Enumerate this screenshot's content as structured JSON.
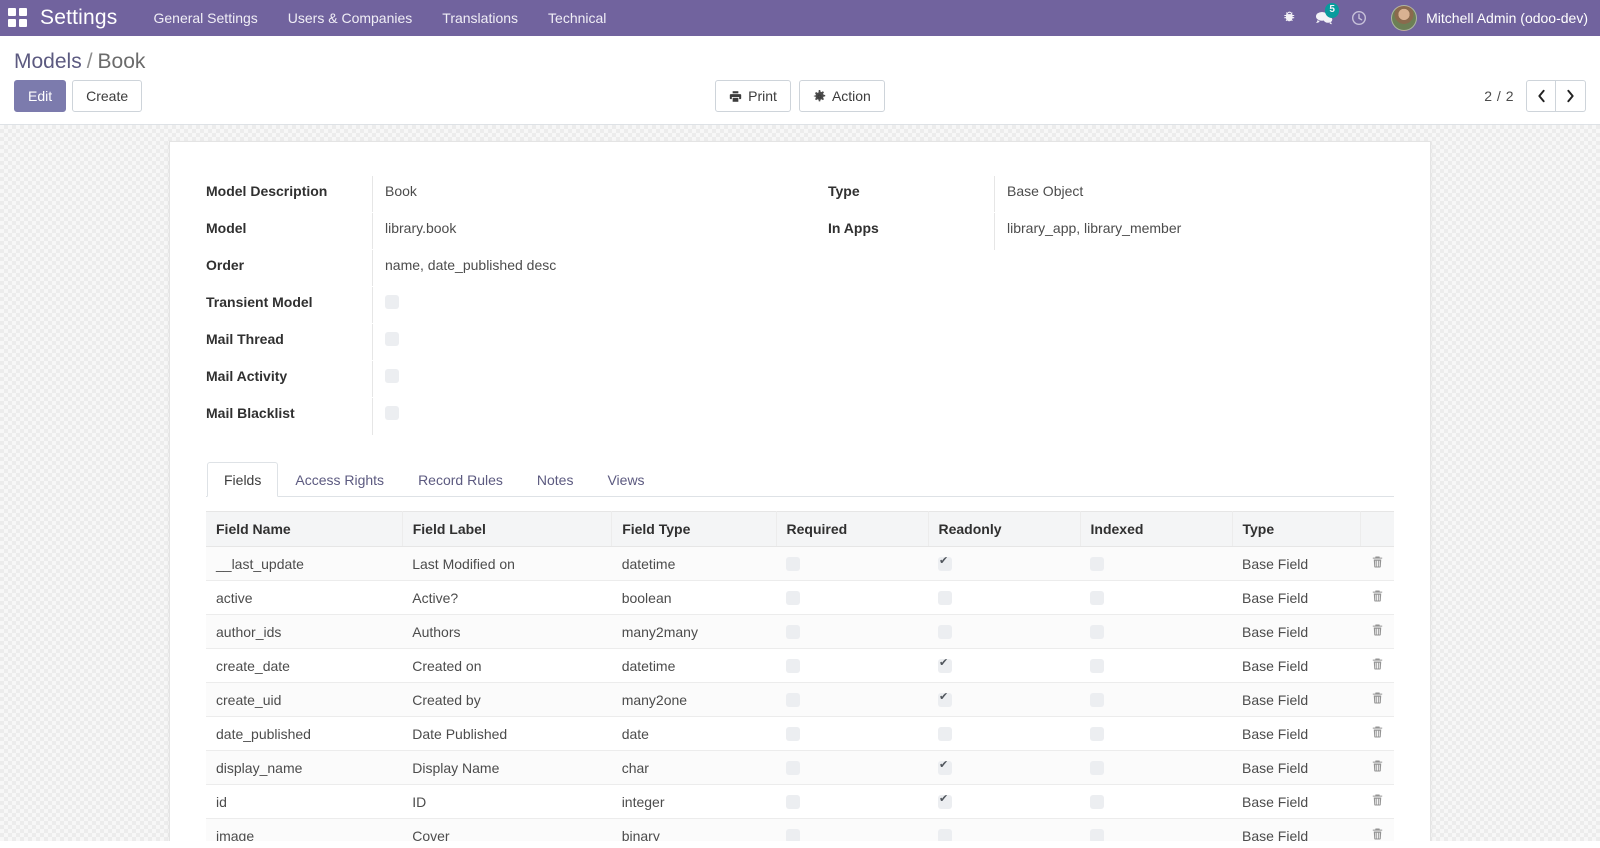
{
  "navbar": {
    "apps_icon": "apps-grid-icon",
    "brand": "Settings",
    "menu": [
      {
        "label": "General Settings"
      },
      {
        "label": "Users & Companies"
      },
      {
        "label": "Translations"
      },
      {
        "label": "Technical"
      }
    ],
    "icons": [
      {
        "name": "bug-icon",
        "glyph": "🐞"
      },
      {
        "name": "messages-icon",
        "glyph": "💬",
        "badge": "5"
      },
      {
        "name": "activities-clock-icon",
        "glyph": "🕑"
      }
    ],
    "user_name": "Mitchell Admin (odoo-dev)",
    "accent_color": "#71639e",
    "badge_color": "#00a09d"
  },
  "control_panel": {
    "breadcrumb": {
      "parent": "Models",
      "separator": "/",
      "current": "Book"
    },
    "edit_label": "Edit",
    "create_label": "Create",
    "print_label": "Print",
    "action_label": "Action",
    "pager": {
      "count": "2 / 2",
      "prev": "‹",
      "next": "›"
    },
    "primary_color": "#7c7bad"
  },
  "form": {
    "left": [
      {
        "label": "Model Description",
        "value": "Book",
        "type": "text"
      },
      {
        "label": "Model",
        "value": "library.book",
        "type": "text"
      },
      {
        "label": "Order",
        "value": "name, date_published desc",
        "type": "text"
      },
      {
        "label": "Transient Model",
        "value": "",
        "type": "checkbox",
        "checked": false
      },
      {
        "label": "Mail Thread",
        "value": "",
        "type": "checkbox",
        "checked": false
      },
      {
        "label": "Mail Activity",
        "value": "",
        "type": "checkbox",
        "checked": false
      },
      {
        "label": "Mail Blacklist",
        "value": "",
        "type": "checkbox",
        "checked": false
      }
    ],
    "right": [
      {
        "label": "Type",
        "value": "Base Object",
        "type": "text"
      },
      {
        "label": "In Apps",
        "value": "library_app, library_member",
        "type": "text"
      }
    ]
  },
  "notebook": {
    "tabs": [
      {
        "label": "Fields",
        "active": true
      },
      {
        "label": "Access Rights",
        "active": false
      },
      {
        "label": "Record Rules",
        "active": false
      },
      {
        "label": "Notes",
        "active": false
      },
      {
        "label": "Views",
        "active": false
      }
    ]
  },
  "fields_table": {
    "columns": [
      "Field Name",
      "Field Label",
      "Field Type",
      "Required",
      "Readonly",
      "Indexed",
      "Type",
      ""
    ],
    "delete_icon": "trash-icon",
    "rows": [
      {
        "field_name": "__last_update",
        "field_label": "Last Modified on",
        "field_type": "datetime",
        "required": false,
        "readonly": true,
        "indexed": false,
        "type": "Base Field"
      },
      {
        "field_name": "active",
        "field_label": "Active?",
        "field_type": "boolean",
        "required": false,
        "readonly": false,
        "indexed": false,
        "type": "Base Field"
      },
      {
        "field_name": "author_ids",
        "field_label": "Authors",
        "field_type": "many2many",
        "required": false,
        "readonly": false,
        "indexed": false,
        "type": "Base Field"
      },
      {
        "field_name": "create_date",
        "field_label": "Created on",
        "field_type": "datetime",
        "required": false,
        "readonly": true,
        "indexed": false,
        "type": "Base Field"
      },
      {
        "field_name": "create_uid",
        "field_label": "Created by",
        "field_type": "many2one",
        "required": false,
        "readonly": true,
        "indexed": false,
        "type": "Base Field"
      },
      {
        "field_name": "date_published",
        "field_label": "Date Published",
        "field_type": "date",
        "required": false,
        "readonly": false,
        "indexed": false,
        "type": "Base Field"
      },
      {
        "field_name": "display_name",
        "field_label": "Display Name",
        "field_type": "char",
        "required": false,
        "readonly": true,
        "indexed": false,
        "type": "Base Field"
      },
      {
        "field_name": "id",
        "field_label": "ID",
        "field_type": "integer",
        "required": false,
        "readonly": true,
        "indexed": false,
        "type": "Base Field"
      },
      {
        "field_name": "image",
        "field_label": "Cover",
        "field_type": "binary",
        "required": false,
        "readonly": false,
        "indexed": false,
        "type": "Base Field"
      }
    ]
  }
}
